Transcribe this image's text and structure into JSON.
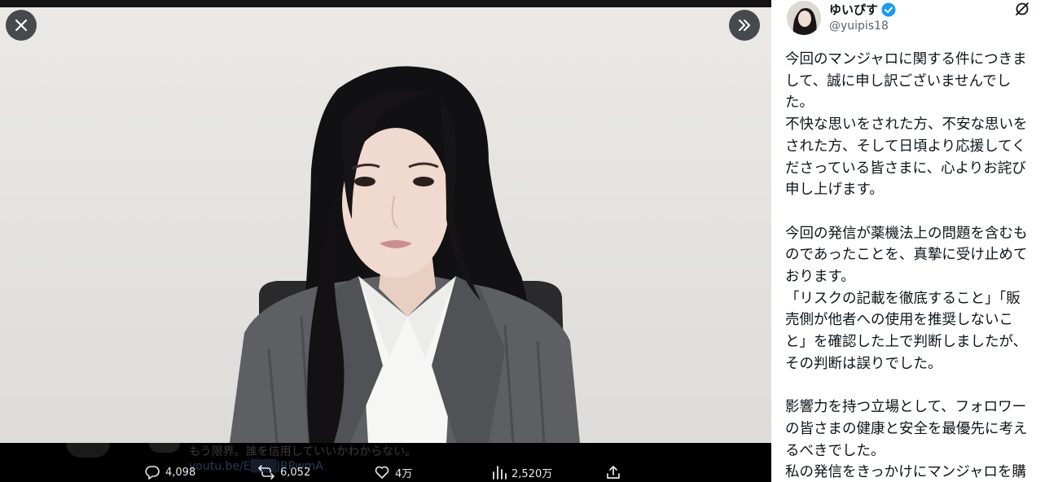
{
  "media": {
    "close_icon": "close-icon",
    "expand_icon": "chevrons-right-icon",
    "background_reply_text": "もう限界。誰を信用していいかわからない。",
    "background_reply_link": "youtu.be/E▒▒▒JRPwmA"
  },
  "actions": {
    "replies": "4,098",
    "reposts": "6,052",
    "likes": "4万",
    "views": "2,520万"
  },
  "author": {
    "display_name": "ゆいぴす",
    "handle": "@yuipis18",
    "verified": true,
    "verified_color": "#1d9bf0"
  },
  "post": {
    "paragraphs": [
      [
        "今回のマンジャロに関する件につきま",
        "して、誠に申し訳ございませんでし",
        "た。",
        "不快な思いをされた方、不安な思いを",
        "された方、そして日頃より応援してく",
        "ださっている皆さまに、心よりお詫び",
        "申し上げます。"
      ],
      [
        "今回の発信が薬機法上の問題を含むも",
        "のであったことを、真摯に受け止めて",
        "おります。",
        "「リスクの記載を徹底すること」「販",
        "売側が他者への使用を推奨しないこ",
        "と」を確認した上で判断しましたが、",
        "その判断は誤りでした。"
      ],
      [
        "影響力を持つ立場として、フォロワー",
        "の皆さまの健康と安全を最優先に考え",
        "るべきでした。",
        "私の発信をきっかけにマンジャロを購"
      ]
    ]
  },
  "colors": {
    "text_primary": "#0f1419",
    "text_secondary": "#536471",
    "action_text": "#e7e9ea"
  }
}
